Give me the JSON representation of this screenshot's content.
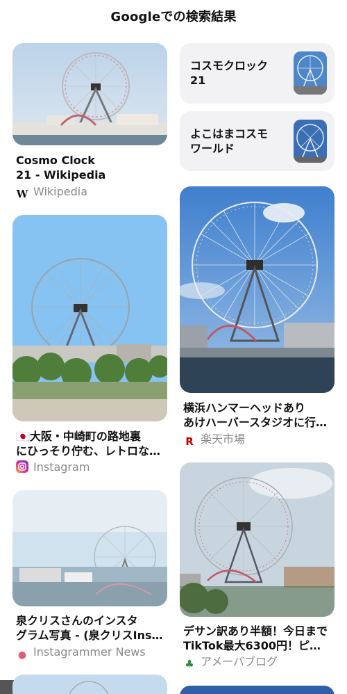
{
  "header": {
    "title": "Googleでの検索結果"
  },
  "results": [
    {
      "caption_lines": [
        "Cosmo Clock",
        "21 - Wikipedia"
      ],
      "source": "Wikipedia",
      "icon": "wikipedia-icon"
    },
    {
      "caption_lines": [
        "🇯🇵大阪・中崎町の路地裏",
        "にひっそり佇む、レトロな…"
      ],
      "source": "Instagram",
      "icon": "instagram-icon"
    },
    {
      "caption_lines": [
        "泉クリスさんのインスタ",
        "グラム写真 - (泉クリスIns…"
      ],
      "source": "Instagrammer News",
      "icon": "instagrammer-news-icon"
    },
    {
      "caption_lines": [
        "横浜ハンマーヘッドあり",
        "あけハーバースタジオに行…"
      ],
      "source": "楽天市場",
      "icon": "rakuten-icon"
    },
    {
      "caption_lines": [
        "デサン訳あり半額！今日まで",
        "TikTok最大6300円！ピ…"
      ],
      "source": "アメーバブログ",
      "icon": "ameba-icon"
    }
  ],
  "related": [
    {
      "label_lines": [
        "コスモクロック",
        "21"
      ]
    },
    {
      "label_lines": [
        "よこはまコスモ",
        "ワールド"
      ]
    }
  ],
  "icons": {
    "wikipedia": "W",
    "rakuten": "R"
  },
  "colors": {
    "background": "#ffffff",
    "chip": "#f2f2f4",
    "source_text": "#8a8a8a",
    "rakuten_red": "#bf0000",
    "instagram": "#d6249f",
    "ameba_green": "#2d8c3c"
  }
}
